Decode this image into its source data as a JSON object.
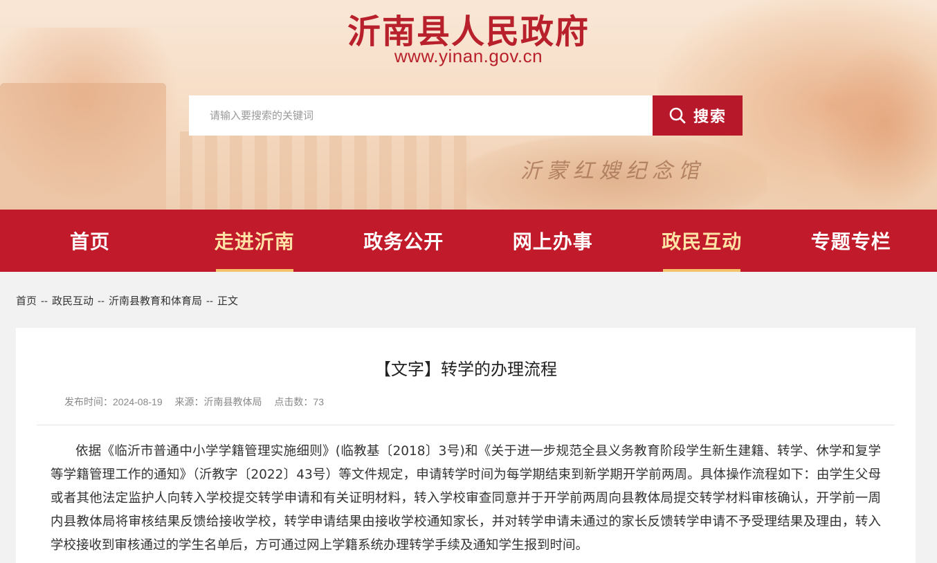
{
  "header": {
    "site_title": "沂南县人民政府",
    "site_url": "www.yinan.gov.cn",
    "rock_inscription": "沂蒙红嫂纪念馆",
    "search_placeholder": "请输入要搜索的关键词",
    "search_button_label": "搜索"
  },
  "nav": {
    "items": [
      {
        "label": "首页"
      },
      {
        "label": "走进沂南",
        "highlighted": true
      },
      {
        "label": "政务公开"
      },
      {
        "label": "网上办事"
      },
      {
        "label": "政民互动",
        "highlighted": true
      },
      {
        "label": "专题专栏"
      }
    ]
  },
  "breadcrumb": {
    "items": [
      "首页",
      "政民互动",
      "沂南县教育和体育局",
      "正文"
    ],
    "separator": "--"
  },
  "article": {
    "title": "【文字】转学的办理流程",
    "publish_time": "发布时间：2024-08-19",
    "source": "来源：沂南县教体局",
    "clicks": "点击数：73",
    "body": "依据《临沂市普通中小学学籍管理实施细则》(临教基〔2018〕3号)和《关于进一步规范全县义务教育阶段学生新生建籍、转学、休学和复学等学籍管理工作的通知》（沂教字〔2022〕43号）等文件规定，申请转学时间为每学期结束到新学期开学前两周。具体操作流程如下：由学生父母或者其他法定监护人向转入学校提交转学申请和有关证明材料，转入学校审查同意并于开学前两周向县教体局提交转学材料审核确认，开学前一周内县教体局将审核结果反馈给接收学校，转学申请结果由接收学校通知家长，并对转学申请未通过的家长反馈转学申请不予受理结果及理由，转入学校接收到审核通过的学生名单后，方可通过网上学籍系统办理转学手续及通知学生报到时间。"
  },
  "colors": {
    "brand_red": "#c11b2b",
    "title_red": "#b8212b",
    "nav_highlight": "#ffe3a6"
  }
}
